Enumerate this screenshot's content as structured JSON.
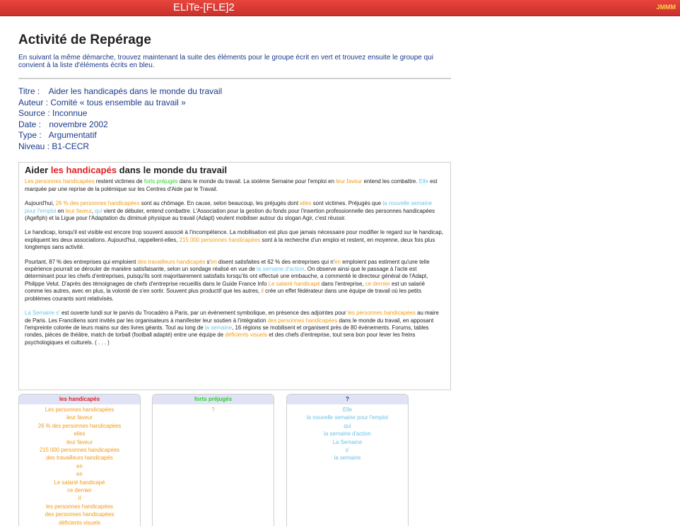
{
  "app": {
    "title": "ELiTe-[FLE]2",
    "user": "JMMM"
  },
  "activity": {
    "title": "Activité de Repérage",
    "instructions": "En suivant la même démarche, trouvez maintenant la suite des éléments pour le groupe écrit en vert et trouvez ensuite le groupe qui convient à la liste d'éléments écrits en bleu."
  },
  "meta": [
    {
      "key": "Titre :",
      "value": "Aider les handicapés dans le monde du travail"
    },
    {
      "key": "Auteur :",
      "value": "Comité « tous ensemble au travail »"
    },
    {
      "key": "Source :",
      "value": "Inconnue"
    },
    {
      "key": "Date :",
      "value": "novembre 2002"
    },
    {
      "key": "Type :",
      "value": "Argumentatif"
    },
    {
      "key": "Niveau :",
      "value": "B1-CECR"
    }
  ],
  "article": {
    "title_before": "Aider ",
    "title_highlight": "les handicapés",
    "title_after": " dans le monde du travail",
    "paragraphs": [
      [
        {
          "t": "Les personnes handicapées",
          "c": "o"
        },
        {
          "t": " restent victimes de ",
          "c": ""
        },
        {
          "t": "forts préjugés",
          "c": "g"
        },
        {
          "t": " dans le monde du travail. La sixième Semaine pour l'emploi en ",
          "c": ""
        },
        {
          "t": "leur faveur",
          "c": "o"
        },
        {
          "t": " entend les combattre. ",
          "c": ""
        },
        {
          "t": "Elle",
          "c": "b"
        },
        {
          "t": " est marquée par une reprise de la polémique sur les Centres d'Aide par le Travail.",
          "c": ""
        }
      ],
      [
        {
          "t": "Aujourd'hui, ",
          "c": ""
        },
        {
          "t": "26 % des personnes handicapées",
          "c": "o"
        },
        {
          "t": " sont au chômage. En cause, selon beaucoup, les préjugés dont ",
          "c": ""
        },
        {
          "t": "elles",
          "c": "o"
        },
        {
          "t": " sont victimes. Préjugés que ",
          "c": ""
        },
        {
          "t": "la nouvelle semaine pour l'emploi",
          "c": "b"
        },
        {
          "t": " en ",
          "c": ""
        },
        {
          "t": "leur faveur",
          "c": "o"
        },
        {
          "t": ", ",
          "c": ""
        },
        {
          "t": "qui",
          "c": "b"
        },
        {
          "t": " vient de débuter, entend combattre. L'Association pour la gestion du fonds pour l'insertion professionnelle des personnes handicapées (Agefiph) et la Ligue pour l'Adaptation du diminué physique au travail (Adapt) veulent mobiliser autour du slogan Agir, c'est réussir.",
          "c": ""
        }
      ],
      [
        {
          "t": "Le handicap, lorsqu'il est visible est encore trop souvent associé à l'incompétence. La mobilisation est plus que jamais nécessaire pour modifier le regard sur le handicap, expliquent les deux associations. Aujourd'hui, rappellent-elles, ",
          "c": ""
        },
        {
          "t": "215 000 personnes handicapées",
          "c": "o"
        },
        {
          "t": " sont à la recherche d'un emploi et restent, en moyenne, deux fois plus longtemps sans activité.",
          "c": ""
        }
      ],
      [
        {
          "t": "Pourtant, 87 % des entreprises qui emploient ",
          "c": ""
        },
        {
          "t": "des travailleurs handicapés",
          "c": "o"
        },
        {
          "t": " s'",
          "c": ""
        },
        {
          "t": "en",
          "c": "o"
        },
        {
          "t": " disent satisfaites et 62 % des entreprises qui n'",
          "c": ""
        },
        {
          "t": "en",
          "c": "o"
        },
        {
          "t": " emploient pas estiment qu'une telle expérience pourrait se dérouler de manière satisfaisante, selon un sondage réalisé en vue de ",
          "c": ""
        },
        {
          "t": "la semaine d'action",
          "c": "b"
        },
        {
          "t": ". On observe ainsi que le passage à l'acte est déterminant pour les chefs d'entreprises, puisqu'ils sont majoritairement satisfaits lorsqu'ils ont effectué une embauche, a commenté le directeur général de l'Adapt, Philippe Velut. D'après des témoignages de chefs d'entreprise recueillis dans le Guide France Info ",
          "c": ""
        },
        {
          "t": "Le salarié handicapé",
          "c": "o"
        },
        {
          "t": " dans l'entreprise, ",
          "c": ""
        },
        {
          "t": "ce dernier",
          "c": "o"
        },
        {
          "t": " est un salarié comme les autres, avec en plus, la volonté de s'en sortir. Souvent plus productif que les autres, ",
          "c": ""
        },
        {
          "t": "il",
          "c": "o"
        },
        {
          "t": " crée un effet fédérateur dans une équipe de travail où les petits problèmes courants sont relativisés.",
          "c": ""
        }
      ],
      [
        {
          "t": "La Semaine s'",
          "c": "b"
        },
        {
          "t": " est ouverte lundi sur le parvis du Trocadéro à Paris, par un événement symbolique, en présence des adjointes pour ",
          "c": ""
        },
        {
          "t": "les personnes handicapées",
          "c": "o"
        },
        {
          "t": " au maire de Paris. Les Franciliens sont invités par les organisateurs à manifester leur soutien à l'intégration ",
          "c": ""
        },
        {
          "t": "des personnes handicapées",
          "c": "o"
        },
        {
          "t": " dans le monde du travail, en apposant l'empreinte colorée de leurs mains sur des livres géants. Tout au long de ",
          "c": ""
        },
        {
          "t": "la semaine",
          "c": "b"
        },
        {
          "t": ", 16 régions se mobilisent et organisent près de 80 événements. Forums, tables rondes, pièces de théâtre, match de torball (football adapté) entre une équipe de ",
          "c": ""
        },
        {
          "t": "déficients visuels",
          "c": "o"
        },
        {
          "t": " et des chefs d'entreprise, tout sera bon pour lever les freins psychologiques et culturels. ( . . . )",
          "c": ""
        }
      ]
    ]
  },
  "groups": [
    {
      "title": "les handicapés",
      "title_color": "#e02020",
      "items_color": "#f29a12",
      "items": [
        "Les personnes handicapées",
        "leur faveur",
        "26 % des personnes handicapées",
        "elles",
        "leur faveur",
        "215 000 personnes handicapées",
        "des travailleurs handicapés",
        "en",
        "en",
        "Le salarié handicapé",
        "ce dernier",
        "il",
        "les personnes handicapées",
        "des personnes handicapées",
        "déficients visuels"
      ]
    },
    {
      "title": "forts préjugés",
      "title_color": "#2ccf2c",
      "items_color": "#f29a12",
      "items": [
        "?"
      ]
    },
    {
      "title": "?",
      "title_color": "#1a3a8a",
      "items_color": "#6cc3e6",
      "items": [
        "Elle",
        "la nouvelle semaine pour l'emploi",
        "qui",
        "la semaine d'action",
        "La Semaine",
        "s'",
        "la semaine"
      ]
    }
  ]
}
